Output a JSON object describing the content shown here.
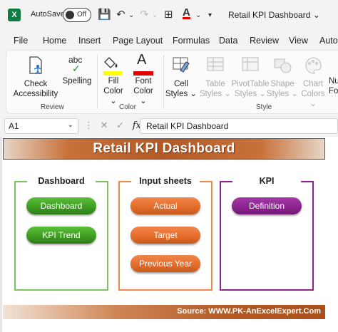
{
  "titlebar": {
    "autosave_label": "AutoSave",
    "autosave_state": "Off",
    "doc_title": "Retail KPI Dashboard"
  },
  "menu": [
    "File",
    "Home",
    "Insert",
    "Page Layout",
    "Formulas",
    "Data",
    "Review",
    "View",
    "Autom"
  ],
  "ribbon": {
    "review_group": "Review",
    "color_group": "Color",
    "style_group": "Style",
    "check_accessibility": [
      "Check",
      "Accessibility"
    ],
    "spelling": "Spelling",
    "spelling_glyph": "abc",
    "fill_color": [
      "Fill",
      "Color ⌄"
    ],
    "font_color": [
      "Font",
      "Color ⌄"
    ],
    "cell_styles": [
      "Cell",
      "Styles ⌄"
    ],
    "table_styles": [
      "Table",
      "Styles ⌄"
    ],
    "pivottable_styles": [
      "PivotTable",
      "Styles ⌄"
    ],
    "shape_styles": [
      "Shape",
      "Styles ⌄"
    ],
    "chart_colors": [
      "Chart",
      "Colors ⌄"
    ],
    "numbers": [
      "Nu",
      "For"
    ],
    "fill_swatch": "#ffff00",
    "font_swatch": "#e00000"
  },
  "formula_bar": {
    "cell_ref": "A1",
    "fx": "fx",
    "content": "Retail KPI Dashboard"
  },
  "sheet": {
    "banner_title": "Retail KPI Dashboard",
    "footer_source": "Source: WWW.PK-AnExcelExpert.Com",
    "panels": {
      "dashboard": {
        "title": "Dashboard",
        "buttons": [
          "Dashboard",
          "KPI Trend"
        ],
        "color": "#6fbf4a"
      },
      "input": {
        "title": "Input sheets",
        "buttons": [
          "Actual",
          "Target",
          "Previous Year"
        ],
        "color": "#e87a3a"
      },
      "kpi": {
        "title": "KPI",
        "buttons": [
          "Definition"
        ],
        "color": "#8c238f"
      }
    }
  }
}
